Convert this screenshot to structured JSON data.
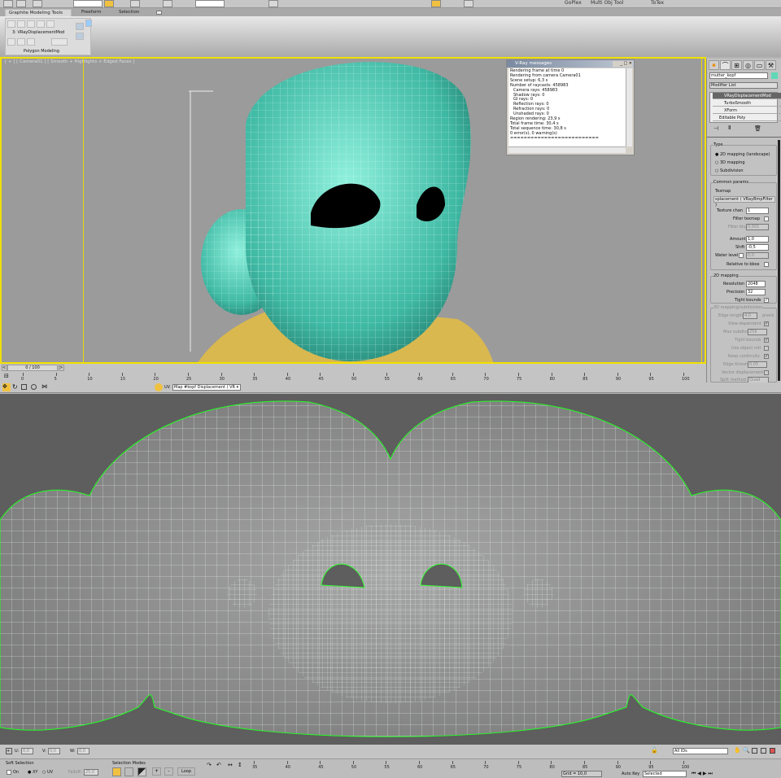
{
  "toolbar": {
    "buttons": [
      "GoPlex",
      "Multi Obj Tool",
      "ToTex"
    ]
  },
  "ribbon": {
    "tabs": [
      "Graphite Modeling Tools",
      "Freeform",
      "Selection"
    ],
    "modifier_label": "3: VRayDisplacementMod",
    "panel_label": "Polygon Modeling"
  },
  "viewport": {
    "label": "[ + ] [ Camera01 ] [ Smooth + Highlights + Edged Faces ]"
  },
  "vray": {
    "title": "V-Ray messages",
    "lines": [
      {
        "t": "Rendering frame at time 0",
        "i": false
      },
      {
        "t": "Rendering from camera Camera01",
        "i": false
      },
      {
        "t": "Scene setup: 6,3 s",
        "i": false
      },
      {
        "t": "Number of raycasts: 458983",
        "i": false
      },
      {
        "t": "Camera rays: 458983",
        "i": true
      },
      {
        "t": "Shadow rays: 0",
        "i": true
      },
      {
        "t": "GI rays: 0",
        "i": true
      },
      {
        "t": "Reflection rays: 0",
        "i": true
      },
      {
        "t": "Refraction rays: 0",
        "i": true
      },
      {
        "t": "Unshaded rays: 0",
        "i": true
      },
      {
        "t": "Region rendering: 23,9 s",
        "i": false
      },
      {
        "t": "Total frame time: 30,4 s",
        "i": false
      },
      {
        "t": "Total sequence time: 30,8 s",
        "i": false
      },
      {
        "t": "0 error(s), 0 warning(s)",
        "i": false
      },
      {
        "t": "==========================",
        "i": false
      }
    ]
  },
  "cmd": {
    "object_name": "mutter_kopf",
    "object_color": "#5fd8b8",
    "modifier_list": "Modifier List",
    "stack": [
      "VRayDisplacementMod",
      "TurboSmooth",
      "XForm",
      "Editable Poly"
    ],
    "type_group": "Type",
    "type_options": [
      "2D mapping (landscape)",
      "3D mapping",
      "Subdivision"
    ],
    "common_group": "Common params",
    "texmap_label": "Texmap",
    "texmap_value": "splacement  ( VRayBmpFilter )",
    "texture_chan_label": "Texture chan",
    "texture_chan": "1",
    "filter_texmap": "Filter texmap",
    "filter_blur_label": "Filter blur",
    "filter_blur": "0,001",
    "amount_label": "Amount",
    "amount": "1,0",
    "shift_label": "Shift",
    "shift": "-0,5",
    "water_label": "Water level",
    "water": "0,0",
    "relative": "Relative to bbox",
    "map2d_group": "2D mapping",
    "resolution_label": "Resolution",
    "resolution": "2048",
    "precision_label": "Precision",
    "precision": "32",
    "tight_bounds": "Tight bounds",
    "sub_group": "3D mapping/subdivision",
    "edge_length_label": "Edge length",
    "edge_length": "4,0",
    "pixels": "pixels",
    "view_dependent": "View-dependent",
    "max_subdivs_label": "Max subdivs",
    "max_subdivs": "256",
    "tight_bounds2": "Tight bounds",
    "use_object_mtl": "Use object mtl",
    "keep_continuity": "Keep continuity",
    "edge_thresh_label": "Edge thresh",
    "edge_thresh": "0,05",
    "vector_disp": "Vector displacement",
    "split_label": "Split method",
    "split": "Quad"
  },
  "timeline": {
    "frame": "0 / 100",
    "ticks": [
      0,
      5,
      10,
      15,
      20,
      25,
      30,
      35,
      40,
      45,
      50,
      55,
      60,
      65,
      70,
      75,
      80,
      85,
      90,
      95,
      100
    ]
  },
  "uv_toolbar": {
    "map_select": "Map #kopf Displacement  ( VR",
    "uv_label": "UV"
  },
  "uvbar": {
    "u_label": "U:",
    "u": "0,0",
    "v_label": "V:",
    "v": "0,0",
    "w_label": "W:",
    "w": "0,0",
    "ids": "All IDs"
  },
  "bottom": {
    "soft_selection": "Soft Selection",
    "on": "On",
    "xy": "XY",
    "uv": "UV",
    "falloff_label": "Falloff:",
    "falloff": "25,0",
    "selection_modes": "Selection Modes",
    "plus": "+",
    "minus": "-",
    "loop": "Loop",
    "ticks": [
      35,
      40,
      45,
      50,
      55,
      60,
      65,
      70,
      75,
      80,
      85,
      90,
      95,
      100
    ],
    "grid": "Grid = 10,0",
    "autokey": "Auto Key",
    "selected": "Selected"
  }
}
